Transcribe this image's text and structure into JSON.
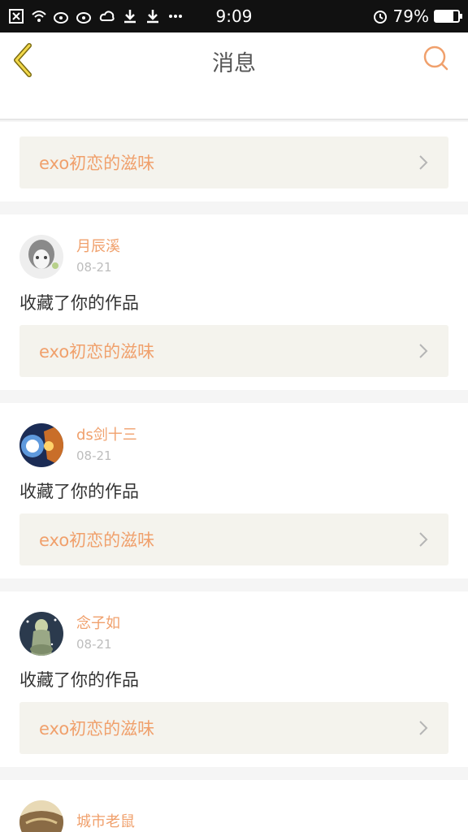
{
  "status_bar": {
    "time": "9:09",
    "battery_text": "79%",
    "battery_level": 0.79
  },
  "nav": {
    "title": "消息",
    "back_icon": "chevron-left-icon",
    "search_icon": "search-icon"
  },
  "top_card": {
    "title": "exo初恋的滋味"
  },
  "messages": [
    {
      "username": "月辰溪",
      "time": "08-21",
      "action": "收藏了你的作品",
      "work_title": "exo初恋的滋味",
      "avatar_colors": [
        "#eeeeee",
        "#8a8a8a"
      ]
    },
    {
      "username": "ds剑十三",
      "time": "08-21",
      "action": "收藏了你的作品",
      "work_title": "exo初恋的滋味",
      "avatar_colors": [
        "#ffffff",
        "#1b2c55"
      ]
    },
    {
      "username": "念子如",
      "time": "08-21",
      "action": "收藏了你的作品",
      "work_title": "exo初恋的滋味",
      "avatar_colors": [
        "#c9d2a6",
        "#2b3a4d"
      ]
    },
    {
      "username": "城市老鼠",
      "avatar_colors": [
        "#e8d9b5",
        "#8a6b45"
      ]
    }
  ],
  "colors": {
    "accent": "#f0a06c",
    "card_bg": "#f4f3ed"
  }
}
